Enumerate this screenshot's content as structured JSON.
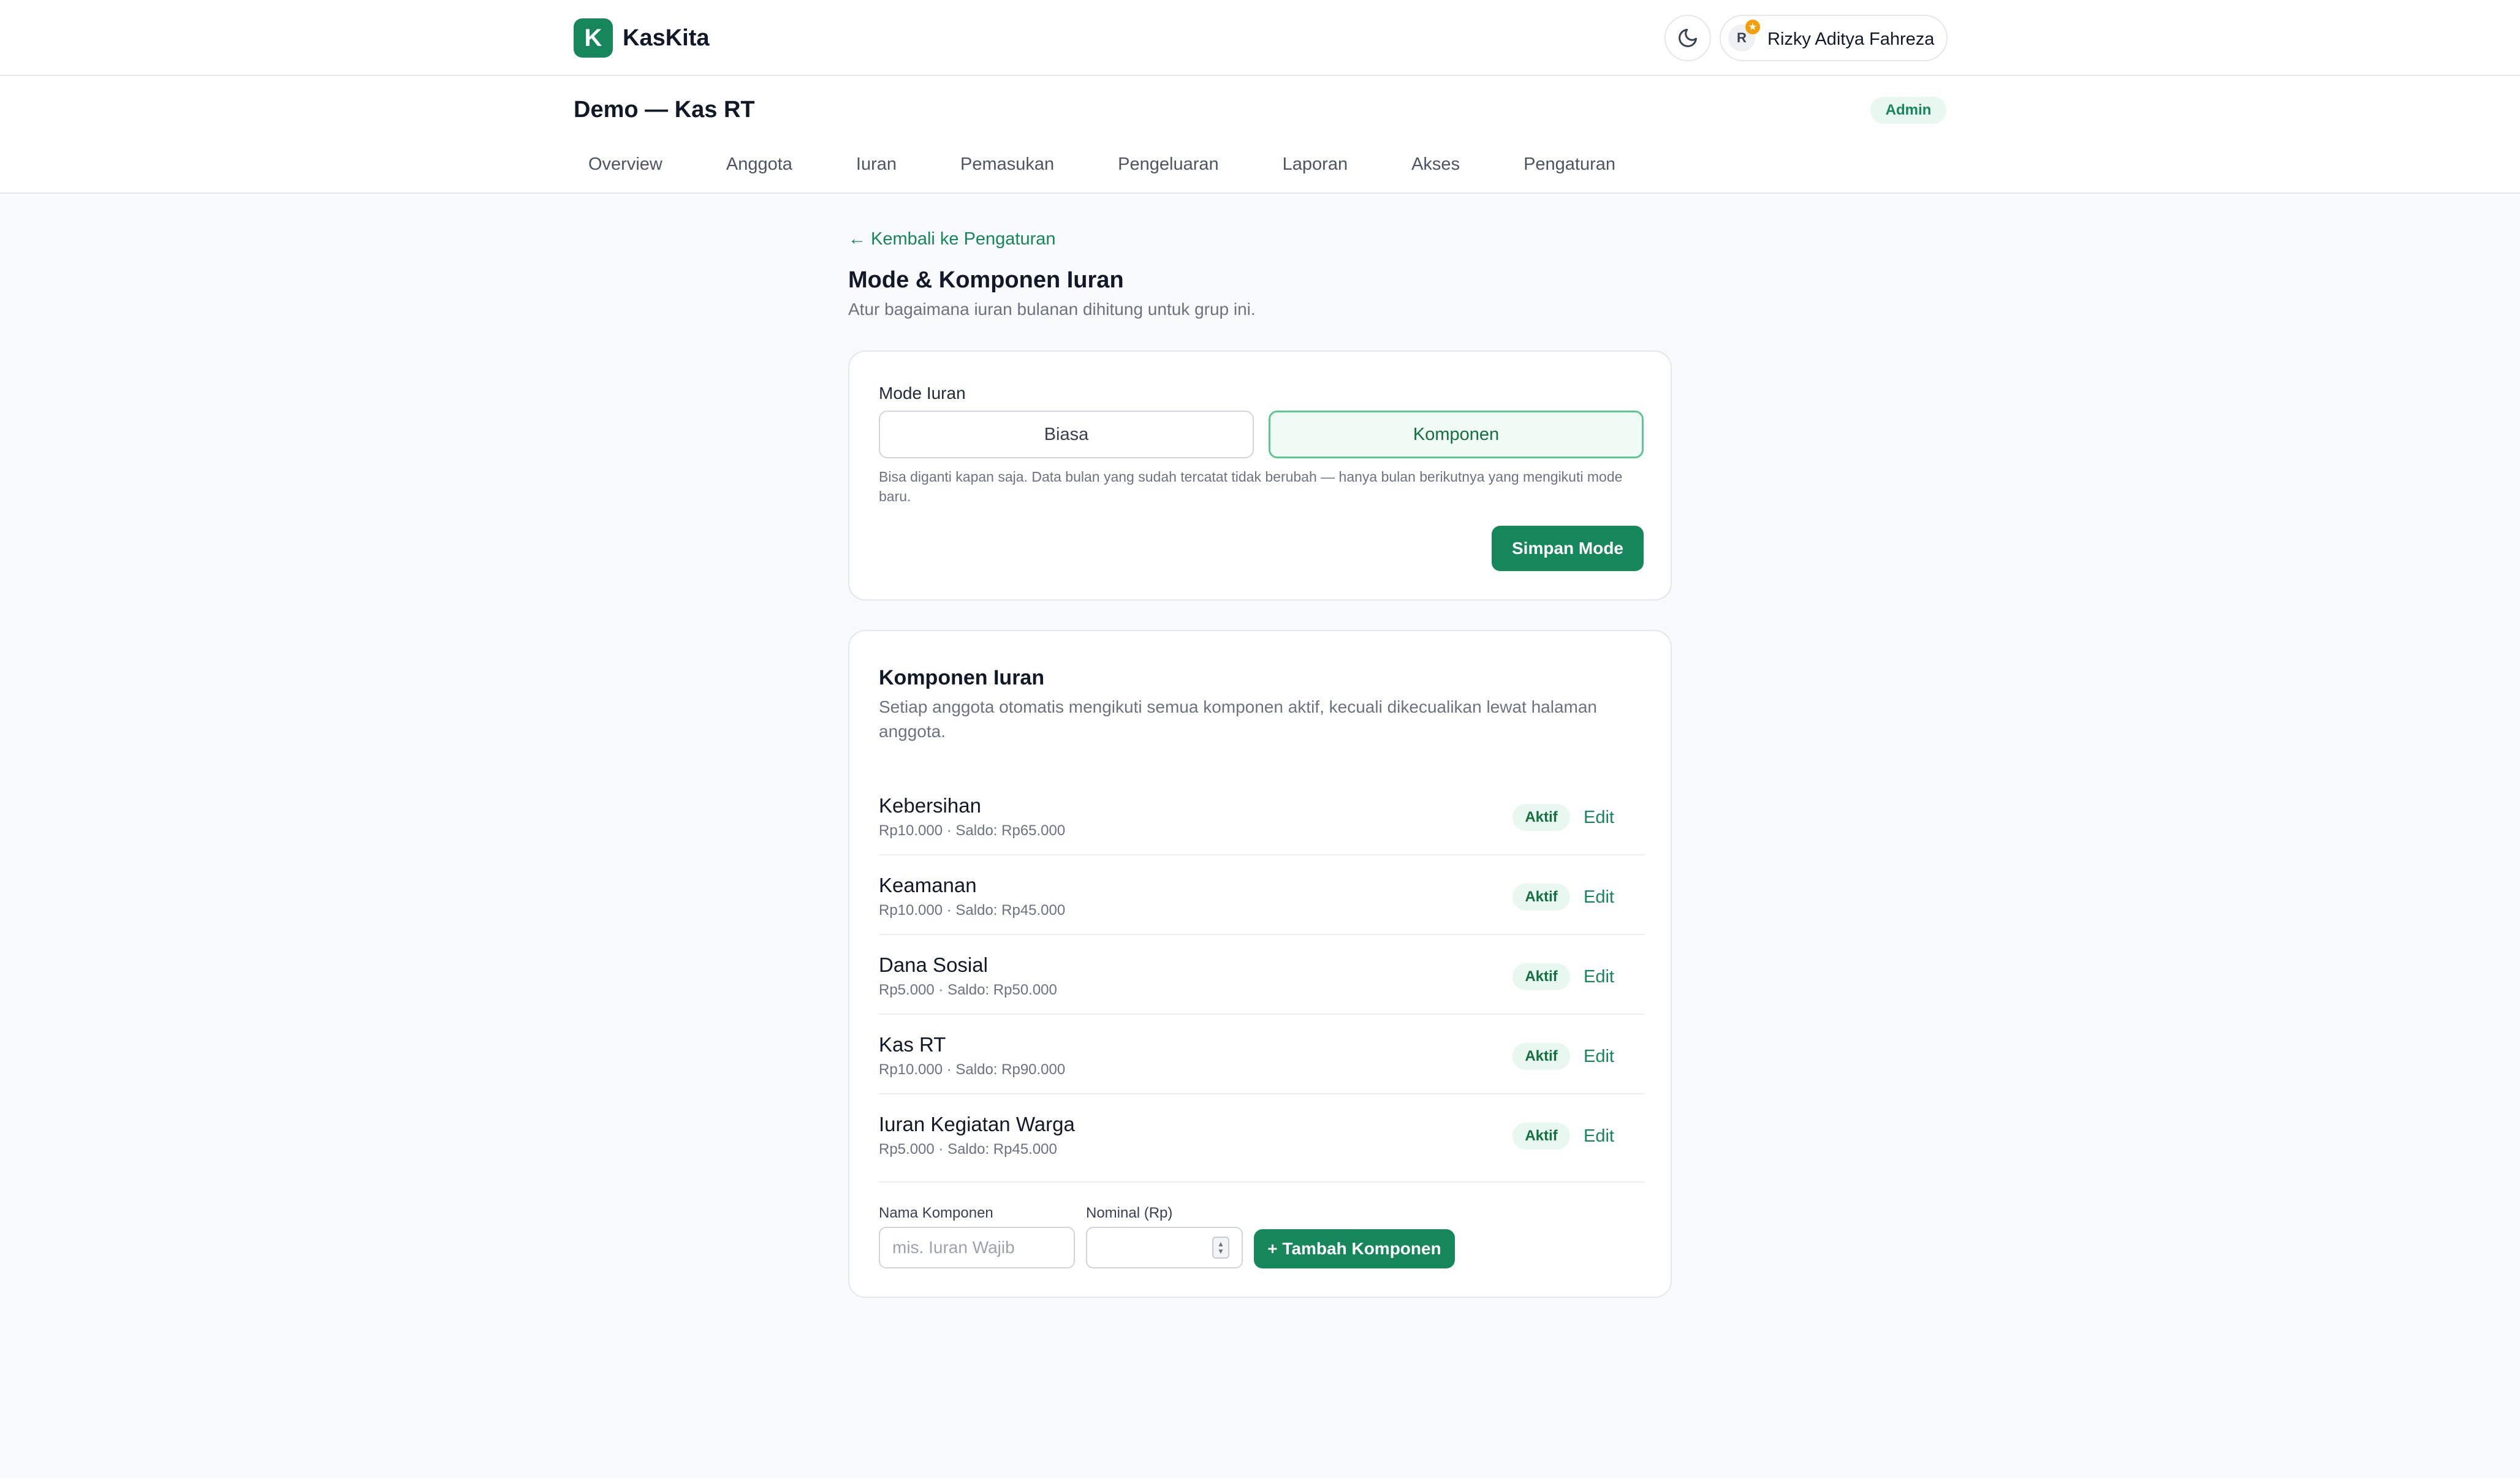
{
  "app": {
    "logo_letter": "K",
    "name": "KasKita"
  },
  "user": {
    "initial": "R",
    "badge_glyph": "★",
    "name": "Rizky Aditya Fahreza"
  },
  "group": {
    "title": "Demo — Kas RT",
    "role": "Admin"
  },
  "nav": [
    "Overview",
    "Anggota",
    "Iuran",
    "Pemasukan",
    "Pengeluaran",
    "Laporan",
    "Akses",
    "Pengaturan"
  ],
  "page": {
    "back_label": "← Kembali ke Pengaturan",
    "title": "Mode & Komponen Iuran",
    "subtitle": "Atur bagaimana iuran bulanan dihitung untuk grup ini."
  },
  "mode": {
    "label": "Mode Iuran",
    "options": [
      "Biasa",
      "Komponen"
    ],
    "selected": "Komponen",
    "note": "Bisa diganti kapan saja. Data bulan yang sudah tercatat tidak berubah — hanya bulan berikutnya yang mengikuti mode baru.",
    "save_label": "Simpan Mode"
  },
  "components": {
    "title": "Komponen Iuran",
    "subtitle": "Setiap anggota otomatis mengikuti semua komponen aktif, kecuali dikecualikan lewat halaman anggota.",
    "items": [
      {
        "name": "Kebersihan",
        "meta": "Rp10.000 · Saldo: Rp65.000",
        "status": "Aktif",
        "action": "Edit"
      },
      {
        "name": "Keamanan",
        "meta": "Rp10.000 · Saldo: Rp45.000",
        "status": "Aktif",
        "action": "Edit"
      },
      {
        "name": "Dana Sosial",
        "meta": "Rp5.000 · Saldo: Rp50.000",
        "status": "Aktif",
        "action": "Edit"
      },
      {
        "name": "Kas RT",
        "meta": "Rp10.000 · Saldo: Rp90.000",
        "status": "Aktif",
        "action": "Edit"
      },
      {
        "name": "Iuran Kegiatan Warga",
        "meta": "Rp5.000 · Saldo: Rp45.000",
        "status": "Aktif",
        "action": "Edit"
      }
    ],
    "form": {
      "name_label": "Nama Komponen",
      "name_placeholder": "mis. Iuran Wajib",
      "name_value": "",
      "nominal_label": "Nominal (Rp)",
      "nominal_value": "",
      "add_label": "+ Tambah Komponen"
    }
  },
  "colors": {
    "accent": "#16875a",
    "accent_soft": "#e8f7ef",
    "selected_border": "#5cc795",
    "badge_star": "#f59e0b"
  },
  "icons": {
    "theme_toggle": "moon-icon",
    "back": "arrow-left-icon",
    "stepper": "spin-arrows-icon"
  }
}
